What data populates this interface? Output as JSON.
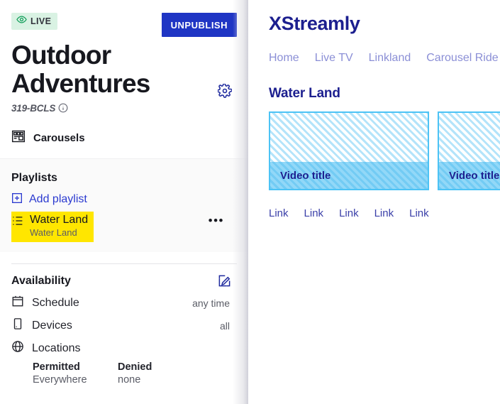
{
  "left_panel": {
    "status_badge": {
      "label": "LIVE",
      "icon": "eye-icon",
      "bg_color": "#d9f2e3",
      "text_color": "#32333c"
    },
    "unpublish_button": {
      "label": "UNPUBLISH",
      "bg_color": "#1f35c4"
    },
    "page_title": "Outdoor Adventures",
    "code": "319-BCLS",
    "settings_icon": "gear-icon",
    "info_icon": "info-icon",
    "carousels_item": {
      "label": "Carousels",
      "icon": "carousel-icon"
    },
    "playlists": {
      "heading": "Playlists",
      "add_playlist": {
        "label": "Add playlist",
        "icon": "plus-square-icon",
        "color": "#2b3ad0"
      },
      "items": [
        {
          "name": "Water Land",
          "subtitle": "Water Land",
          "icon": "list-icon",
          "highlight_color": "#ffe600",
          "menu_label": "•••"
        }
      ]
    },
    "availability": {
      "heading": "Availability",
      "edit_icon": "edit-pencil-icon",
      "rows": [
        {
          "icon": "calendar-icon",
          "label": "Schedule",
          "value": "any time"
        },
        {
          "icon": "device-icon",
          "label": "Devices",
          "value": "all"
        },
        {
          "icon": "globe-icon",
          "label": "Locations",
          "value": ""
        }
      ],
      "locations": {
        "permitted_header": "Permitted",
        "permitted_value": "Everywhere",
        "denied_header": "Denied",
        "denied_value": "none"
      }
    }
  },
  "right_panel": {
    "brand": "XStreamly",
    "brand_color": "#1c1f8f",
    "nav_links": [
      "Home",
      "Live TV",
      "Linkland",
      "Carousel Ride"
    ],
    "carousel_heading": "Water Land",
    "cards": [
      {
        "title": "Video title"
      },
      {
        "title": "Video title"
      }
    ],
    "footer_links": [
      "Link",
      "Link",
      "Link",
      "Link",
      "Link"
    ]
  }
}
